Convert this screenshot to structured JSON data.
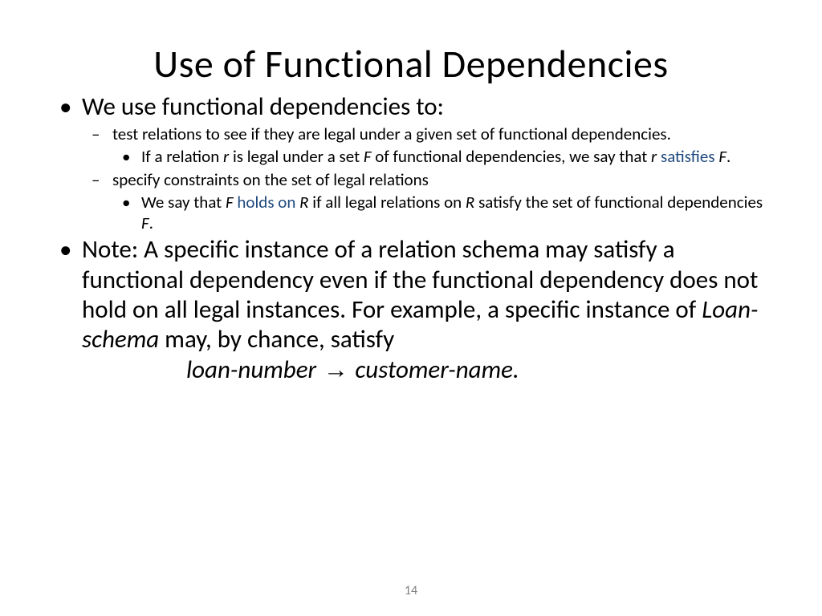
{
  "title": "Use of Functional Dependencies",
  "b1": "We use functional dependencies to:",
  "b1a": "test relations to see if they are legal under a given set of functional dependencies.",
  "b1a1_pre": " If a relation ",
  "r": "r",
  "b1a1_mid1": " is legal under a set ",
  "F": "F",
  "b1a1_mid2": " of functional dependencies, we say that ",
  "satisfies": "satisfies",
  "b1a1_end": ".",
  "b1b": "specify constraints on the set of legal relations",
  "b1b1_pre": "We say that ",
  "holds_on": " holds on ",
  "R": "R",
  "b1b1_mid": " if all legal relations on ",
  "b1b1_end": " satisfy the set of functional dependencies ",
  "note_pre": "Note:  A specific instance of a relation schema may satisfy a functional dependency even if the functional dependency does not hold on all legal instances.  For example, a specific instance of ",
  "loan_schema": "Loan-schema",
  "note_post": " may, by chance, satisfy ",
  "fd_left": "loan-number",
  "arrow": " → ",
  "fd_right": "customer-name.",
  "page_number": "14"
}
